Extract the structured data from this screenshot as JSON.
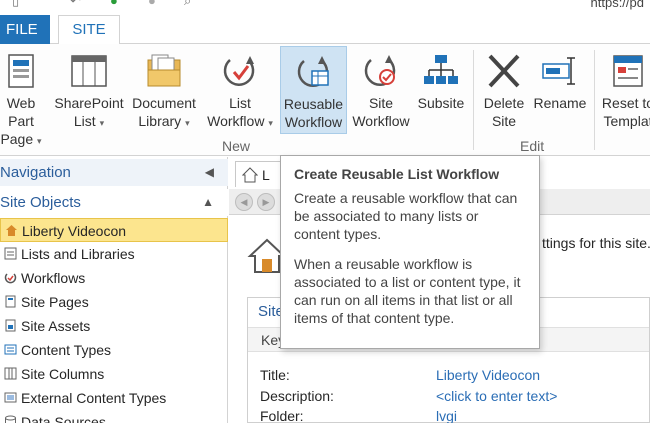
{
  "titlebar": {
    "url": "https://pd"
  },
  "tabs": {
    "file": "FILE",
    "site": "SITE"
  },
  "ribbon": {
    "buttons": [
      {
        "line1": "Web Part",
        "line2": "Page"
      },
      {
        "line1": "SharePoint",
        "line2": "List"
      },
      {
        "line1": "Document",
        "line2": "Library"
      },
      {
        "line1": "List",
        "line2": "Workflow"
      },
      {
        "line1": "Reusable",
        "line2": "Workflow"
      },
      {
        "line1": "Site",
        "line2": "Workflow"
      },
      {
        "line1": "Subsite",
        "line2": ""
      },
      {
        "line1": "Delete",
        "line2": "Site"
      },
      {
        "line1": "Rename",
        "line2": ""
      },
      {
        "line1": "Reset to",
        "line2": "Templat"
      }
    ],
    "groups": {
      "new": "New",
      "edit": "Edit"
    },
    "colors": {
      "active_bg": "#cfe3f3",
      "accent": "#2072b8"
    }
  },
  "nav": {
    "navigation_label": "Navigation",
    "site_objects_label": "Site Objects",
    "items": [
      "Liberty Videocon",
      "Lists and Libraries",
      "Workflows",
      "Site Pages",
      "Site Assets",
      "Content Types",
      "Site Columns",
      "External Content Types",
      "Data Sources"
    ]
  },
  "main": {
    "tab_label": "L",
    "settings_text": "ttings for this site.",
    "site_box_title": "Site",
    "site_box_sub": "Key",
    "props": [
      {
        "label": "Title:",
        "value": "Liberty Videocon"
      },
      {
        "label": "Description:",
        "value": "<click to enter text>"
      },
      {
        "label": "Folder:",
        "value": "lvgi"
      }
    ]
  },
  "tooltip": {
    "title": "Create Reusable List Workflow",
    "para1": "Create a reusable workflow that can be associated to many lists or content types.",
    "para2": "When a reusable workflow is associated to a list or content type, it can run on all items in that list or all items of that content type."
  }
}
